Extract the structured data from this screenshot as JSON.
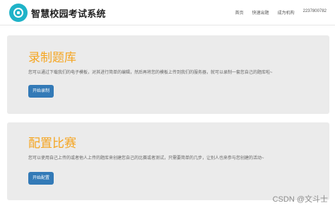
{
  "header": {
    "brand": "智慧校园考试系统",
    "logo_icon": "school-logo-icon",
    "nav": [
      {
        "label": "首页"
      },
      {
        "label": "快速出题"
      },
      {
        "label": "成为机构"
      },
      {
        "label": "2237800782"
      }
    ]
  },
  "panels": [
    {
      "title": "录制题库",
      "description": "您可以通过下载我们的电子模板，对其进行简单的编辑，然后再将您的模板上传到我们的服务器，就可以录制一套您自己的题库啦~",
      "button": "开始录制"
    },
    {
      "title": "配置比赛",
      "description": "您可以使用自己上传的或者他人上传的题库来创建您自己的比赛或者测试，只需要简单的几步，让别人也来参与您创建的活动~",
      "button": "开始配置"
    }
  ],
  "watermark": "CSDN @文斗士",
  "colors": {
    "accent_title": "#f5a623",
    "button": "#337ab7",
    "panel_bg": "#ebebeb",
    "logo": "#1fb3c8"
  }
}
